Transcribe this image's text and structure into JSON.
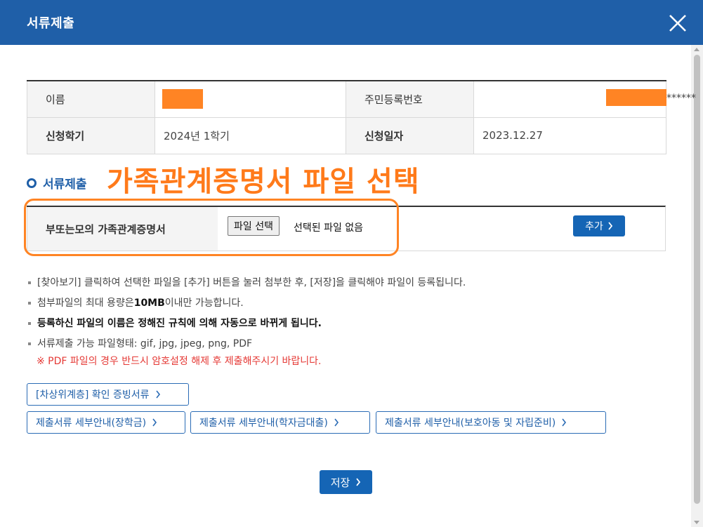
{
  "header": {
    "title": "서류제출"
  },
  "info": {
    "name_label": "이름",
    "rrn_label": "주민등록번호",
    "rrn_suffix": "******",
    "semester_label": "신청학기",
    "semester_value": "2024년 1학기",
    "date_label": "신청일자",
    "date_value": "2023.12.27"
  },
  "section": {
    "title": "서류제출",
    "annotation": "가족관계증명서 파일 선택"
  },
  "upload": {
    "row_label": "부또는모의 가족관계증명서",
    "file_button": "파일 선택",
    "file_status": "선택된 파일 없음",
    "add_button": "추가"
  },
  "notes": {
    "n1": "[찾아보기] 클릭하여 선택한 파일을 [추가] 버튼을 눌러 첨부한 후, [저장]을 클릭해야 파일이 등록됩니다.",
    "n2_a": "첨부파일의 최대 용량은 ",
    "n2_b": "10MB",
    "n2_c": "이내만 가능합니다.",
    "n3": "등록하신 파일의 이름은 정해진 규칙에 의해 자동으로 바뀌게 됩니다.",
    "n4": "서류제출 가능 파일형태: gif, jpg, jpeg, png, PDF",
    "warning": "※ PDF 파일의 경우 반드시 암호설정 해제 후 제출해주시기 바랍니다."
  },
  "links": {
    "l1": "[차상위계층] 확인 증빙서류",
    "l2": "제출서류 세부안내(장학금)",
    "l3": "제출서류 세부안내(학자금대출)",
    "l4": "제출서류 세부안내(보호아동 및 자립준비)"
  },
  "save_button": "저장",
  "colors": {
    "header_bg": "#1f5fa8",
    "primary_button": "#1565b5",
    "annotation": "#ff7a1a",
    "redaction": "#ff8424",
    "warning": "#e53935"
  }
}
